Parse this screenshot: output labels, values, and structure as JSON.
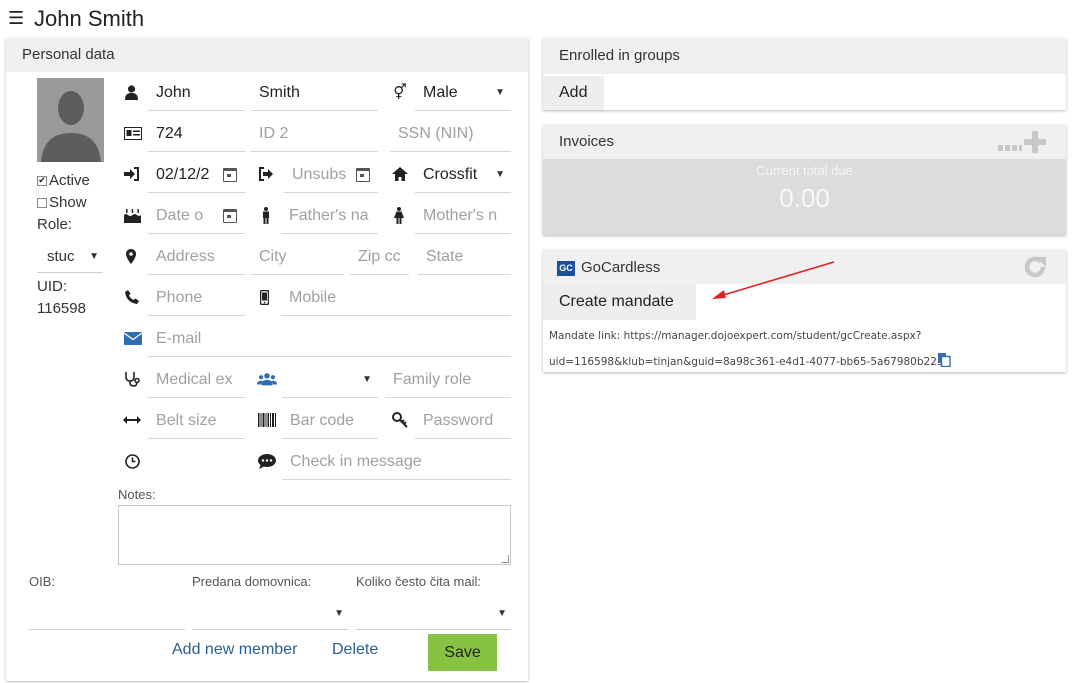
{
  "header": {
    "title": "John Smith",
    "menu_icon": "☰"
  },
  "personal": {
    "title": "Personal data",
    "active_label": "Active",
    "active_checked": true,
    "show_label": "Show",
    "show_checked": false,
    "role_label": "Role:",
    "role_value": "stuc",
    "uid_label": "UID:",
    "uid_value": "116598",
    "fields": {
      "first_name": "John",
      "last_name": "Smith",
      "gender": "Male",
      "id1": "724",
      "id2_placeholder": "ID 2",
      "ssn_placeholder": "SSN (NIN)",
      "start_date": "02/12/2",
      "unsub_placeholder": "Unsubs",
      "club": "Crossfit",
      "birth_placeholder": "Date o",
      "father_placeholder": "Father's na",
      "mother_placeholder": "Mother's n",
      "address_placeholder": "Address",
      "city_placeholder": "City",
      "zip_placeholder": "Zip cc",
      "state_placeholder": "State",
      "phone_placeholder": "Phone",
      "mobile_placeholder": "Mobile",
      "email_placeholder": "E-mail",
      "medical_placeholder": "Medical ex",
      "family_select": "",
      "family_role_placeholder": "Family role",
      "belt_placeholder": "Belt size",
      "barcode_placeholder": "Bar code",
      "password_placeholder": "Password",
      "checkin_placeholder": "Check in message"
    },
    "notes_label": "Notes:",
    "oib_label": "OIB:",
    "predana_label": "Predana domovnica:",
    "koliko_label": "Koliko često čita mail:",
    "add_member": "Add new member",
    "delete": "Delete",
    "save": "Save"
  },
  "groups": {
    "title": "Enrolled in groups",
    "add": "Add"
  },
  "invoices": {
    "title": "Invoices",
    "subtitle": "Current total due",
    "value": "0.00"
  },
  "gocardless": {
    "logo": "GC",
    "title": "GoCardless",
    "create_mandate": "Create mandate",
    "link_line1": "Mandate link: https://manager.dojoexpert.com/student/gcCreate.aspx?",
    "link_line2": "uid=116598&klub=tinjan&guid=8a98c361-e4d1-4077-bb65-5a67980b225e"
  },
  "colors": {
    "save_green": "#87c242",
    "link_blue": "#2a5f95",
    "annotation_red": "#e02020"
  }
}
